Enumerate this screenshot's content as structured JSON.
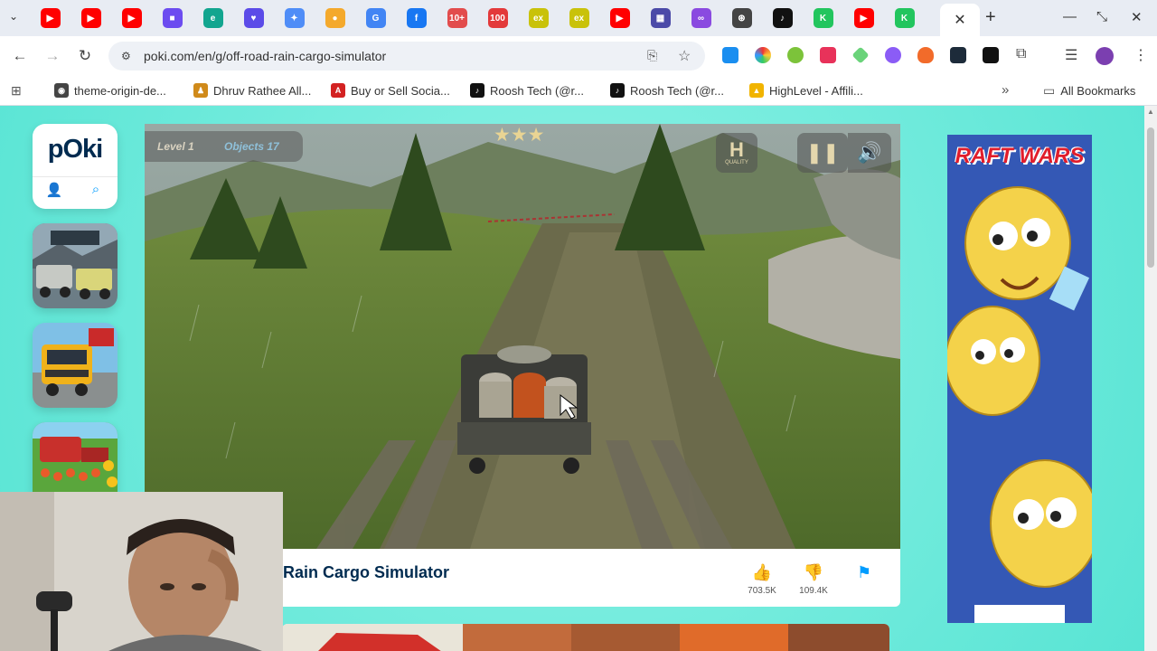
{
  "browser": {
    "tabs": [
      {
        "icon": "youtube-icon",
        "color": "#ff0000",
        "glyph": "▶"
      },
      {
        "icon": "youtube-icon",
        "color": "#ff0000",
        "glyph": "▶"
      },
      {
        "icon": "youtube-icon",
        "color": "#ff0000",
        "glyph": "▶"
      },
      {
        "icon": "video-app-icon",
        "color": "#6c4cf0",
        "glyph": "■"
      },
      {
        "icon": "edge-icon",
        "color": "#12a58f",
        "glyph": "e"
      },
      {
        "icon": "chat-heart-icon",
        "color": "#5b4be8",
        "glyph": "♥"
      },
      {
        "icon": "gemini-icon",
        "color": "#4f8df7",
        "glyph": "✦"
      },
      {
        "icon": "apps-icon",
        "color": "#f4a92c",
        "glyph": "●"
      },
      {
        "icon": "google-icon",
        "color": "#4285f4",
        "glyph": "G"
      },
      {
        "icon": "facebook-icon",
        "color": "#1877f2",
        "glyph": "f"
      },
      {
        "icon": "tenplus-icon",
        "color": "#e24c4c",
        "glyph": "10+"
      },
      {
        "icon": "hundred-icon",
        "color": "#e3393a",
        "glyph": "100"
      },
      {
        "icon": "ex-icon",
        "color": "#c9c20a",
        "glyph": "ex"
      },
      {
        "icon": "ex-icon",
        "color": "#c9c20a",
        "glyph": "ex"
      },
      {
        "icon": "youtube-icon",
        "color": "#ff0000",
        "glyph": "▶"
      },
      {
        "icon": "calendar-icon",
        "color": "#4b4aa8",
        "glyph": "▦"
      },
      {
        "icon": "link-icon",
        "color": "#8a4ae0",
        "glyph": "∞"
      },
      {
        "icon": "openai-icon",
        "color": "#444444",
        "glyph": "⊛"
      },
      {
        "icon": "tiktok-icon",
        "color": "#111111",
        "glyph": "♪"
      },
      {
        "icon": "kick-icon",
        "color": "#22c55e",
        "glyph": "K"
      },
      {
        "icon": "youtube-icon",
        "color": "#ff0000",
        "glyph": "▶"
      },
      {
        "icon": "kick-icon",
        "color": "#22c55e",
        "glyph": "K"
      }
    ],
    "active_tab_close": "✕",
    "new_tab": "+",
    "url": "poki.com/en/g/off-road-rain-cargo-simulator",
    "bookmarks": [
      {
        "label": "theme-origin-de...",
        "icon": "globe-icon",
        "color": "#444444",
        "glyph": "◉"
      },
      {
        "label": "Dhruv Rathee All...",
        "icon": "person-icon",
        "color": "#d08a1a",
        "glyph": "♟"
      },
      {
        "label": "Buy or Sell Socia...",
        "icon": "a-logo-icon",
        "color": "#d32222",
        "glyph": "A"
      },
      {
        "label": "Roosh Tech (@r...",
        "icon": "tiktok-icon",
        "color": "#111111",
        "glyph": "♪"
      },
      {
        "label": "Roosh Tech (@r...",
        "icon": "tiktok-icon",
        "color": "#111111",
        "glyph": "♪"
      },
      {
        "label": "HighLevel - Affili...",
        "icon": "highlevel-icon",
        "color": "#f1b400",
        "glyph": "▲"
      }
    ],
    "all_bookmarks": "All Bookmarks",
    "more_bookmarks": "»"
  },
  "sidebar": {
    "logo": "pOki",
    "user_icon": "user-icon",
    "search_icon": "search-icon"
  },
  "game": {
    "level_label": "Level 1",
    "objects_label": "Objects 17",
    "stars": "★★★",
    "quality_label": "QUALITY",
    "title": "Rain Cargo Simulator",
    "likes": "703.5K",
    "dislikes": "109.4K"
  },
  "ad": {
    "brand": "RAFT WARS"
  }
}
